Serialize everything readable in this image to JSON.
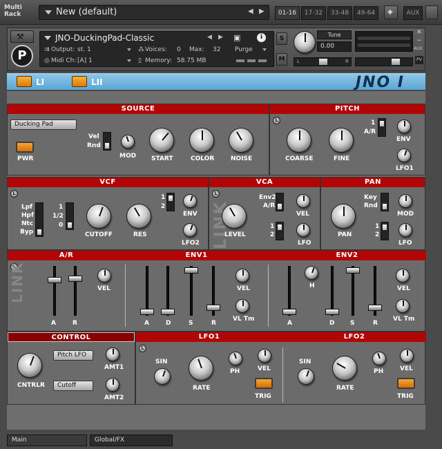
{
  "rack": {
    "label_line1": "Multi",
    "label_line2": "Rack",
    "preset": "New (default)",
    "pages": [
      "01-16",
      "17-32",
      "33-48",
      "49-64"
    ],
    "aux": "AUX"
  },
  "instrument": {
    "name": "JNO-DuckingPad-Classic",
    "output_label": "Output:",
    "output_value": "st. 1",
    "voices_label": "Voices:",
    "voices_value": "0",
    "max_label": "Max:",
    "max_value": "32",
    "purge": "Purge",
    "midi_label": "Midi Ch:",
    "midi_value": "[A] 1",
    "memory_label": "Memory:",
    "memory_value": "58.75 MB",
    "s_button": "S",
    "m_button": "M",
    "tune_label": "Tune",
    "tune_value": "0.00",
    "pan_l": "L",
    "pan_r": "R",
    "aux_small": "AUX",
    "pv_small": "PV"
  },
  "title_strip": {
    "tab1": "LI",
    "tab2": "LII",
    "logo": "JNO I"
  },
  "source": {
    "header": "SOURCE",
    "dropdown": "Ducking Pad",
    "pwr": "PWR",
    "vel": "Vel",
    "rnd": "Rnd",
    "mod": "MOD",
    "start": "START",
    "color": "COLOR",
    "noise": "NOISE"
  },
  "pitch": {
    "header": "PITCH",
    "coarse": "COARSE",
    "fine": "FINE",
    "sw1": "1",
    "ar": "A/R",
    "env": "ENV",
    "lfo1": "LFO1"
  },
  "vcf": {
    "header": "VCF",
    "lpf": "Lpf",
    "hpf": "Hpf",
    "ntc": "Ntc",
    "byp": "Byp",
    "s1": "1",
    "s_half": "1/2",
    "s0": "0",
    "cutoff": "CUTOFF",
    "res": "RES",
    "n1": "1",
    "n2": "2",
    "env": "ENV",
    "lfo2": "LFO2"
  },
  "vca": {
    "header": "VCA",
    "env2": "Env2",
    "ar": "A/R",
    "vel": "VEL",
    "level": "LEVEL",
    "n1": "1",
    "n2": "2",
    "lfo": "LFO",
    "link": "LINK"
  },
  "pan": {
    "header": "PAN",
    "key": "Key",
    "rnd": "Rnd",
    "mod": "MOD",
    "pan": "PAN",
    "n1": "1",
    "n2": "2",
    "lfo": "LFO"
  },
  "ar": {
    "header": "A/R",
    "a": "A",
    "r": "R",
    "vel": "VEL",
    "link": "LINK"
  },
  "env1": {
    "header": "ENV1",
    "a": "A",
    "d": "D",
    "s": "S",
    "r": "R",
    "vel": "VEL",
    "vltm": "VL Tm"
  },
  "env2": {
    "header": "ENV2",
    "a": "A",
    "h": "H",
    "d": "D",
    "s": "S",
    "r": "R",
    "vel": "VEL",
    "vltm": "VL Tm"
  },
  "control": {
    "header": "CONTROL",
    "cntrlr": "CNTRLR",
    "pitch_lfo": "Pitch LFO",
    "cutoff": "Cutoff",
    "amt1": "AMT1",
    "amt2": "AMT2"
  },
  "lfo1": {
    "header": "LFO1",
    "sin": "SIN",
    "rate": "RATE",
    "ph": "PH",
    "vel": "VEL",
    "trig": "TRIG"
  },
  "lfo2": {
    "header": "LFO2",
    "sin": "SIN",
    "rate": "RATE",
    "ph": "PH",
    "vel": "VEL",
    "trig": "TRIG"
  },
  "bottom_tabs": [
    "Main",
    "Global/FX"
  ]
}
